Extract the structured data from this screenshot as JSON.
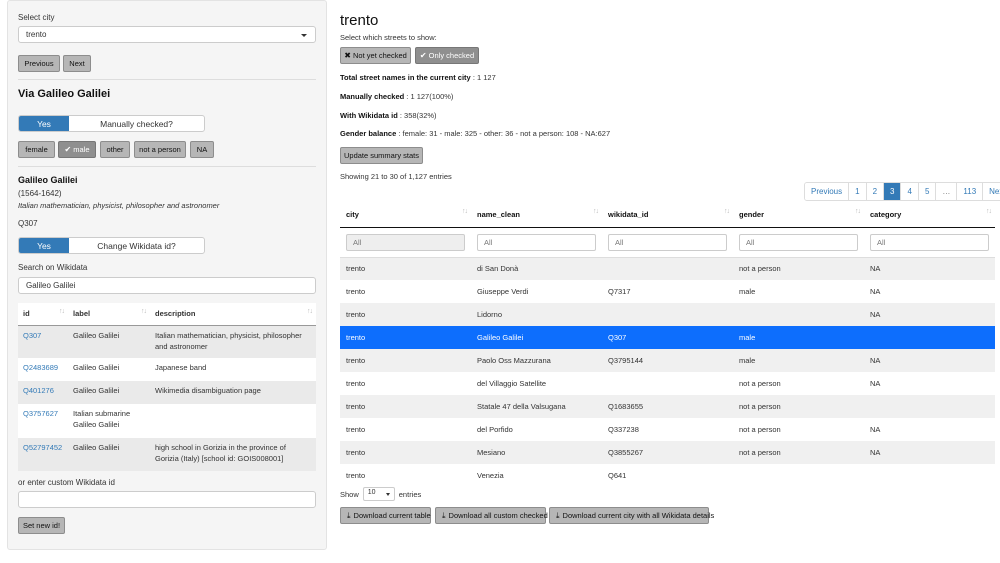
{
  "sidebar": {
    "select_city_label": "Select city",
    "city_value": "trento",
    "prev_label": "Previous",
    "next_label": "Next",
    "street_title": "Via Galileo Galilei",
    "manual_toggle_on": "Yes",
    "manual_toggle_label": "Manually checked?",
    "gender_buttons": [
      "female",
      "male",
      "other",
      "not a person",
      "NA"
    ],
    "entity_name": "Galileo Galilei",
    "entity_dates": "(1564-1642)",
    "entity_desc": "Italian mathematician, physicist, philosopher and astronomer",
    "entity_qid": "Q307",
    "wikidata_toggle_on": "Yes",
    "wikidata_toggle_label": "Change Wikidata id?",
    "search_label": "Search on Wikidata",
    "search_value": "Galileo Galilei",
    "table_headers": [
      "id",
      "label",
      "description"
    ],
    "table_rows": [
      {
        "id": "Q307",
        "label": "Galileo Galilei",
        "description": "Italian mathematician, physicist, philosopher and astronomer"
      },
      {
        "id": "Q2483689",
        "label": "Galileo Galilei",
        "description": "Japanese band"
      },
      {
        "id": "Q401276",
        "label": "Galileo Galilei",
        "description": "Wikimedia disambiguation page"
      },
      {
        "id": "Q3757627",
        "label": "Italian submarine Galileo Galilei",
        "description": ""
      },
      {
        "id": "Q52797452",
        "label": "Galileo Galilei",
        "description": "high school in Gorizia in the province of Gorizia (Italy) [school id: GOIS008001]"
      }
    ],
    "custom_id_label": "or enter custom Wikidata id",
    "custom_id_value": "",
    "set_id_label": "Set new id!"
  },
  "main": {
    "title": "trento",
    "subtitle": "Select which streets to show:",
    "filter_not_checked": "Not yet checked",
    "filter_only_checked": "Only checked",
    "stats": [
      {
        "label": "Total street names in the current city",
        "value": " : 1 127"
      },
      {
        "label": "Manually checked",
        "value": " : 1 127(100%)"
      },
      {
        "label": "With Wikidata id",
        "value": " : 358(32%)"
      },
      {
        "label": "Gender balance",
        "value": " : female: 31 - male: 325 - other: 36 - not a person: 108 - NA:627"
      }
    ],
    "update_btn": "Update summary stats",
    "showing": "Showing 21 to 30 of 1,127 entries",
    "pagination": [
      "Previous",
      "1",
      "2",
      "3",
      "4",
      "5",
      "…",
      "113",
      "Next"
    ],
    "current_page": "3",
    "columns": [
      "city",
      "name_clean",
      "wikidata_id",
      "gender",
      "category"
    ],
    "filter_placeholder": "All",
    "rows": [
      [
        "trento",
        "di San Donà",
        "",
        "not a person",
        "NA"
      ],
      [
        "trento",
        "Giuseppe Verdi",
        "Q7317",
        "male",
        "NA"
      ],
      [
        "trento",
        "Lidorno",
        "",
        "",
        "NA"
      ],
      [
        "trento",
        "Galileo Galilei",
        "Q307",
        "male",
        ""
      ],
      [
        "trento",
        "Paolo Oss Mazzurana",
        "Q3795144",
        "male",
        "NA"
      ],
      [
        "trento",
        "del Villaggio Satellite",
        "",
        "not a person",
        "NA"
      ],
      [
        "trento",
        "Statale 47 della Valsugana",
        "Q1683655",
        "not a person",
        ""
      ],
      [
        "trento",
        "del Porfido",
        "Q337238",
        "not a person",
        "NA"
      ],
      [
        "trento",
        "Mesiano",
        "Q3855267",
        "not a person",
        "NA"
      ],
      [
        "trento",
        "Venezia",
        "Q641",
        "",
        ""
      ]
    ],
    "selected_row": 3,
    "show_label": "Show",
    "entries_value": "10",
    "entries_label": "entries",
    "download_buttons": [
      "Download current table",
      "Download all custom checked",
      "Download current city with all Wikidata details"
    ]
  }
}
